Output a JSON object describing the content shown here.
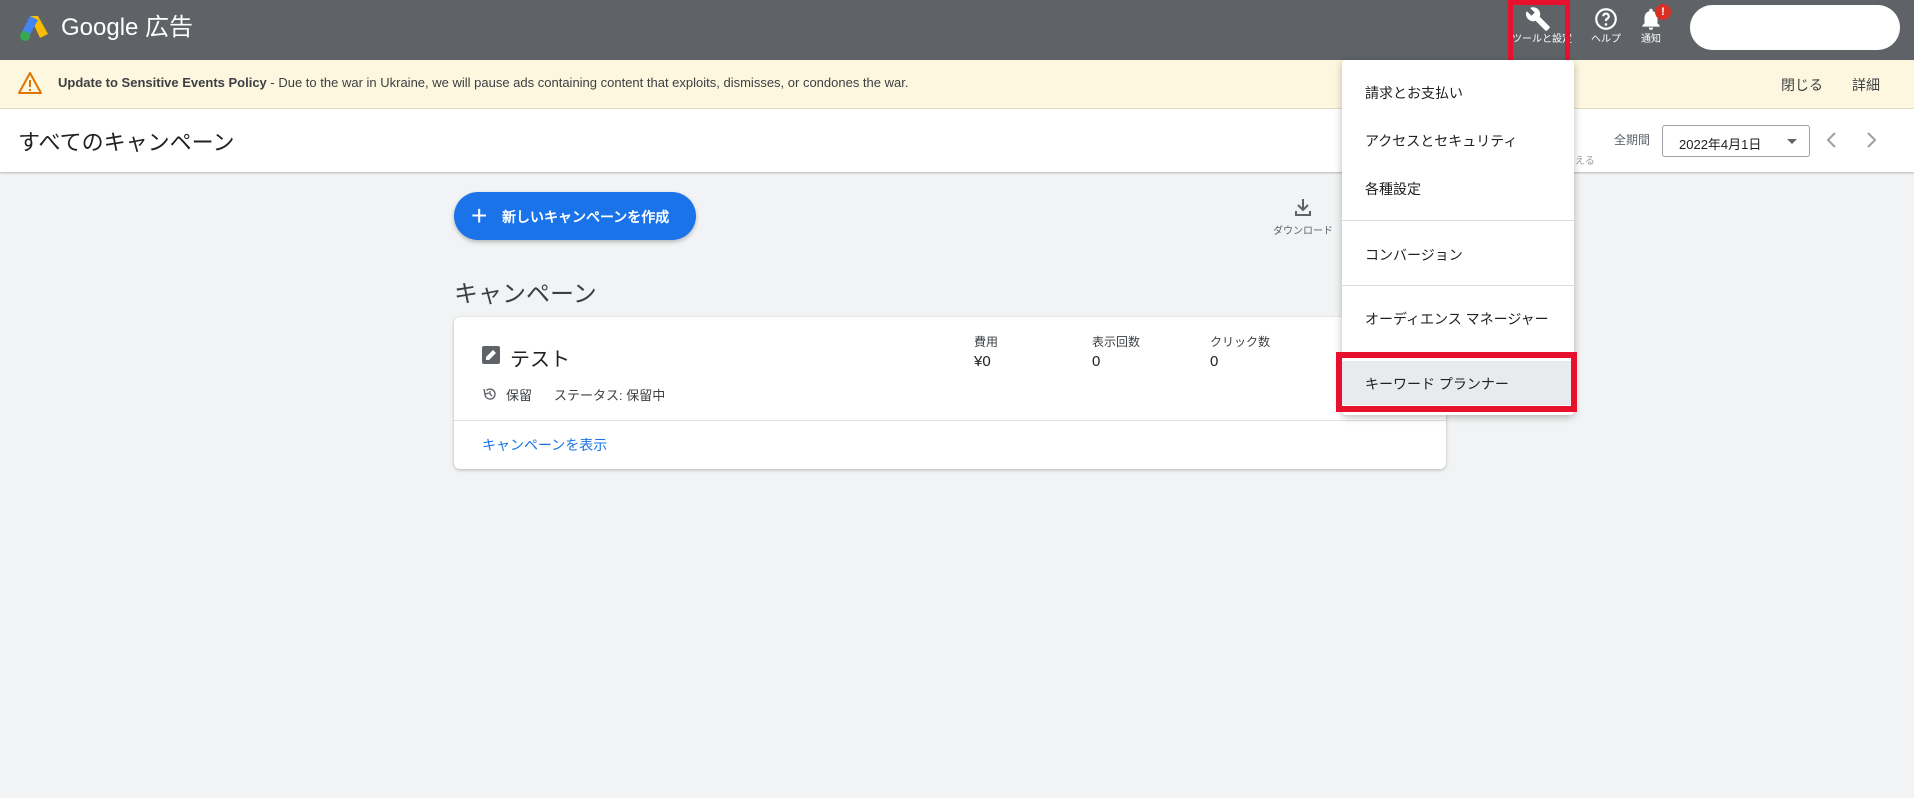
{
  "header": {
    "app_title": "Google 広告",
    "tools_label": "ツールと設定",
    "help_label": "ヘルプ",
    "notifications_label": "通知",
    "notification_badge": "!"
  },
  "banner": {
    "bold_text": "Update to Sensitive Events Policy",
    "text": " - Due to the war in Ukraine, we will pause ads containing content that exploits, dismisses, or condones the war.",
    "close_label": "閉じる",
    "detail_label": "詳細"
  },
  "page": {
    "title": "すべてのキャンペーン",
    "period_label": "全期間",
    "partial_hidden_text": "える",
    "date_value": "2022年4月1日"
  },
  "main": {
    "new_campaign_label": "新しいキャンペーンを作成",
    "download_label": "ダウンロード",
    "section_title": "キャンペーン"
  },
  "campaign_card": {
    "name": "テスト",
    "metrics": [
      {
        "label": "費用",
        "value": "¥0"
      },
      {
        "label": "表示回数",
        "value": "0"
      },
      {
        "label": "クリック数",
        "value": "0"
      }
    ],
    "status_hold": "保留",
    "status_text": "ステータス: 保留中",
    "view_link": "キャンペーンを表示"
  },
  "tools_menu": {
    "items": [
      {
        "label": "請求とお支払い"
      },
      {
        "label": "アクセスとセキュリティ"
      },
      {
        "label": "各種設定"
      },
      {
        "label": "コンバージョン"
      },
      {
        "label": "オーディエンス マネージャー"
      },
      {
        "label": "キーワード プランナー"
      }
    ]
  },
  "colors": {
    "topbar": "#5f6368",
    "accent": "#1a73e8",
    "highlight": "#e8112d",
    "banner_bg": "#fef7e0",
    "badge": "#d93025"
  }
}
